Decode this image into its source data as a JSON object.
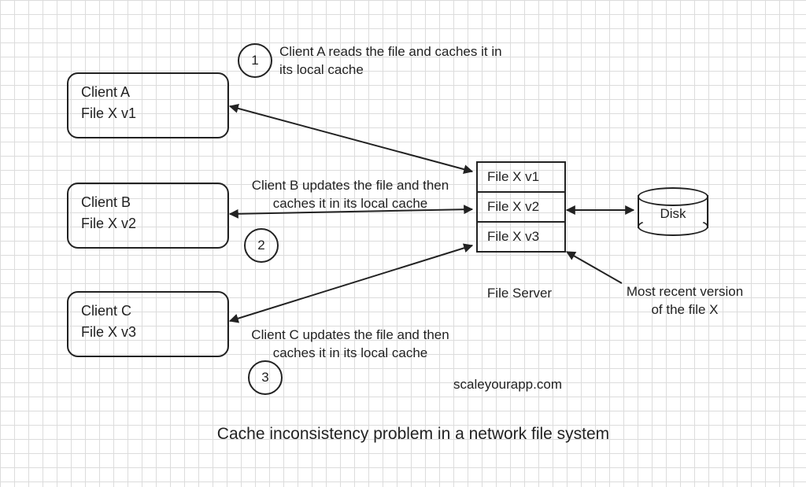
{
  "clients": {
    "a": {
      "name": "Client A",
      "file": "File X v1"
    },
    "b": {
      "name": "Client B",
      "file": "File X v2"
    },
    "c": {
      "name": "Client C",
      "file": "File X v3"
    }
  },
  "server": {
    "label": "File Server",
    "rows": {
      "r1": "File X v1",
      "r2": "File X v2",
      "r3": "File X v3"
    }
  },
  "disk": {
    "label": "Disk"
  },
  "steps": {
    "s1": {
      "num": "1",
      "text": "Client A reads the file and caches it in\nits local cache"
    },
    "s2": {
      "num": "2",
      "text": "Client B updates the file and then\ncaches it in its local cache"
    },
    "s3": {
      "num": "3",
      "text": "Client C updates the file and then\ncaches it in its local cache"
    }
  },
  "annotations": {
    "recent": "Most recent version\nof the file X",
    "site": "scaleyourapp.com"
  },
  "title": "Cache inconsistency problem in a network file system"
}
